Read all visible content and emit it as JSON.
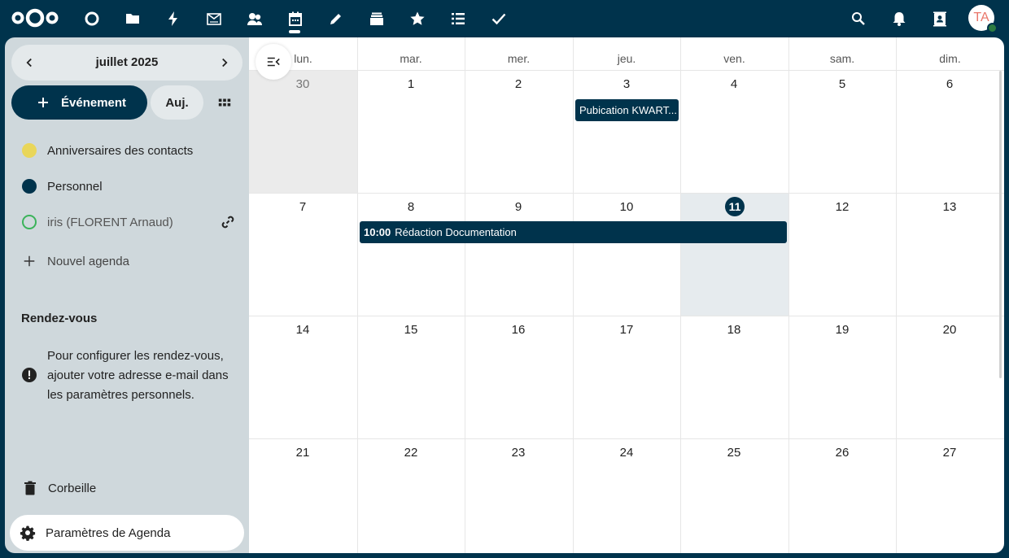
{
  "topbar": {
    "apps": [
      "dashboard-icon",
      "files-icon",
      "activity-icon",
      "mail-icon",
      "contacts-group-icon",
      "calendar-icon",
      "notes-icon",
      "deck-icon",
      "favorites-icon",
      "tasks-list-icon",
      "check-icon"
    ],
    "active_app": "calendar-icon",
    "user_initials": "TA"
  },
  "sidebar": {
    "month_label": "juillet 2025",
    "new_event_label": "Événement",
    "today_label": "Auj.",
    "calendars": [
      {
        "label": "Anniversaires des contacts",
        "color": "#e9d65a"
      },
      {
        "label": "Personnel",
        "color": "#00334c"
      },
      {
        "label": "iris (FLORENT Arnaud)",
        "color": "#3bb35a"
      }
    ],
    "new_calendar_label": "Nouvel agenda",
    "appointments_title": "Rendez-vous",
    "appointments_notice": "Pour configurer les rendez-vous, ajouter votre adresse e-mail dans les paramètres personnels.",
    "trash_label": "Corbeille",
    "settings_label": "Paramètres de Agenda"
  },
  "calendar": {
    "weekdays": [
      "lun.",
      "mar.",
      "mer.",
      "jeu.",
      "ven.",
      "sam.",
      "dim."
    ],
    "weeks": [
      [
        "30",
        "1",
        "2",
        "3",
        "4",
        "5",
        "6"
      ],
      [
        "7",
        "8",
        "9",
        "10",
        "11",
        "12",
        "13"
      ],
      [
        "14",
        "15",
        "16",
        "17",
        "18",
        "19",
        "20"
      ],
      [
        "21",
        "22",
        "23",
        "24",
        "25",
        "26",
        "27"
      ]
    ],
    "today": "11",
    "events": [
      {
        "title": "Pubication KWART...",
        "time": ""
      },
      {
        "title": "Rédaction Documentation",
        "time": "10:00"
      }
    ],
    "colors": {
      "accent": "#00334c",
      "other_month_bg": "#ebebeb",
      "today_col_bg": "#e6ebee"
    }
  }
}
